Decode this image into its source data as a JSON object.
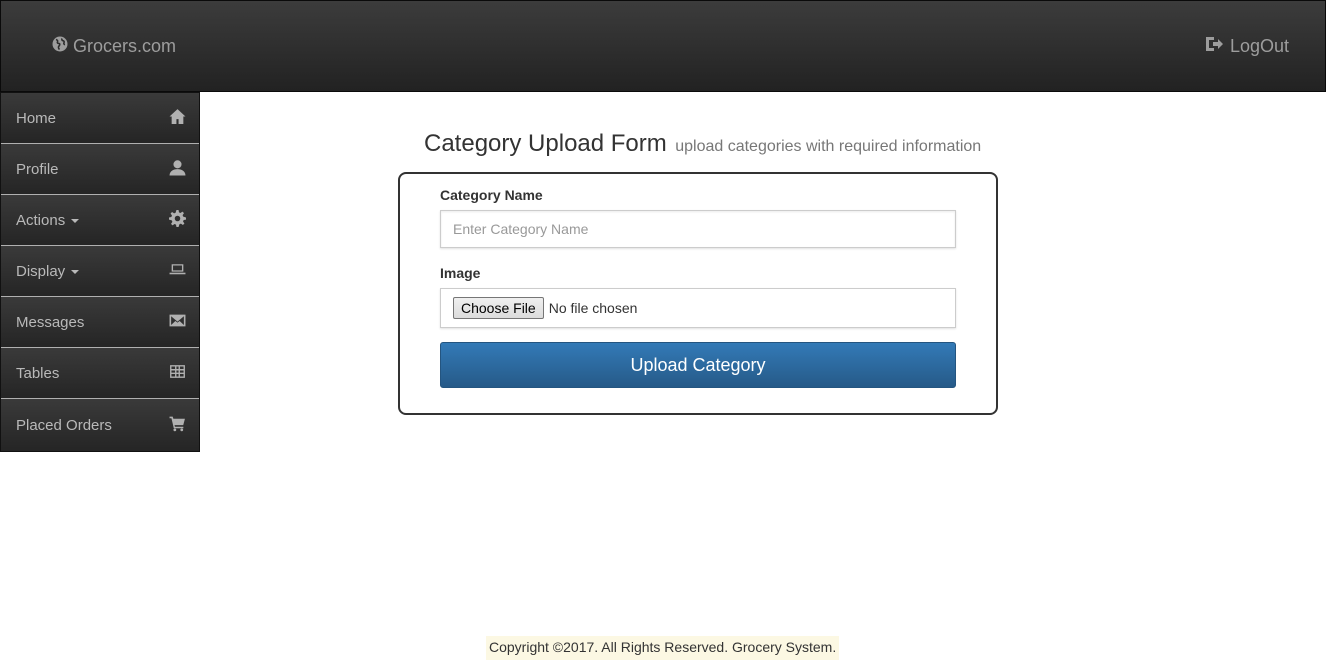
{
  "navbar": {
    "brand": "Grocers.com",
    "brand_icon": "globe-icon",
    "logout_label": "LogOut",
    "logout_icon": "log-out-icon"
  },
  "sidebar": {
    "items": [
      {
        "label": "Home",
        "icon": "home-icon",
        "dropdown": false
      },
      {
        "label": "Profile",
        "icon": "user-icon",
        "dropdown": false
      },
      {
        "label": "Actions",
        "icon": "gear-icon",
        "dropdown": true
      },
      {
        "label": "Display",
        "icon": "laptop-icon",
        "dropdown": true
      },
      {
        "label": "Messages",
        "icon": "envelope-icon",
        "dropdown": false
      },
      {
        "label": "Tables",
        "icon": "table-icon",
        "dropdown": false
      },
      {
        "label": "Placed Orders",
        "icon": "cart-icon",
        "dropdown": false
      }
    ]
  },
  "form": {
    "title": "Category Upload Form",
    "subtitle": "upload categories with required information",
    "category_name_label": "Category Name",
    "category_name_value": "",
    "category_name_placeholder": "Enter Category Name",
    "image_label": "Image",
    "choose_file_label": "Choose File",
    "file_status": "No file chosen",
    "submit_label": "Upload Category"
  },
  "footer": {
    "text": "Copyright ©2017. All Rights Reserved. Grocery System."
  },
  "colors": {
    "navbar_bg": "#222222",
    "primary_button": "#337ab7",
    "footer_highlight": "#fcf8e3"
  }
}
